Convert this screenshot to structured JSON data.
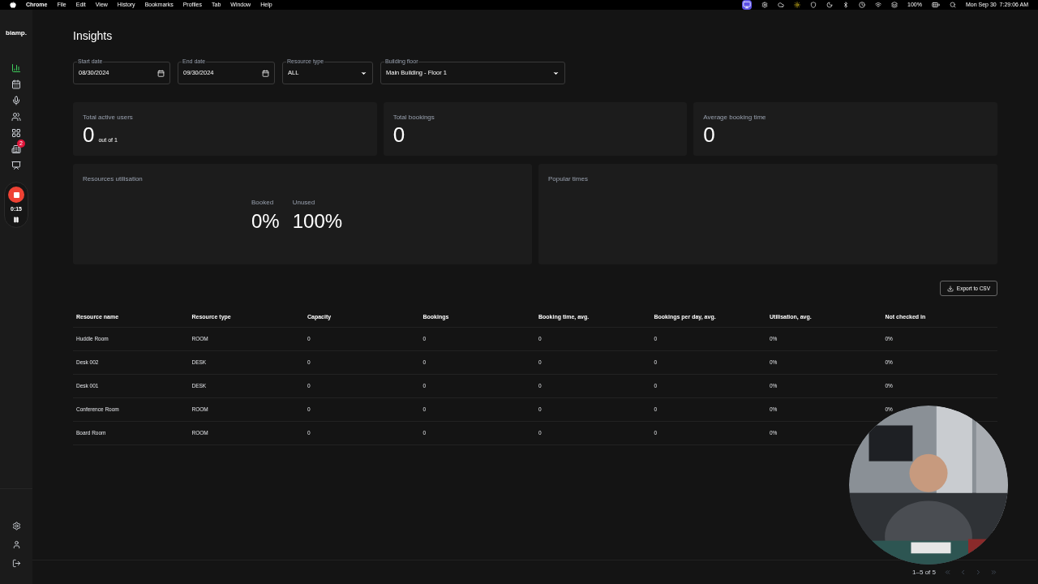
{
  "menu_bar": {
    "app": "Chrome",
    "menus": [
      "File",
      "Edit",
      "View",
      "History",
      "Bookmarks",
      "Profiles",
      "Tab",
      "Window",
      "Help"
    ],
    "battery": "100%",
    "clock": "Mon Sep 30  7:29:06 AM"
  },
  "sidebar": {
    "logo": "biamp.",
    "items": [
      {
        "kind": "chart",
        "selected": true
      },
      {
        "kind": "calendar",
        "selected": false
      },
      {
        "kind": "mic",
        "selected": false
      },
      {
        "kind": "people",
        "selected": false
      },
      {
        "kind": "grid",
        "selected": false
      },
      {
        "kind": "building",
        "selected": false,
        "badge": "2"
      },
      {
        "kind": "desk",
        "selected": false
      }
    ],
    "recorder": {
      "time": "0:15"
    },
    "bottom_items": [
      {
        "kind": "settings"
      },
      {
        "kind": "user"
      },
      {
        "kind": "logout"
      }
    ]
  },
  "page": {
    "title": "Insights"
  },
  "filters": [
    {
      "kind": "date",
      "label": "Start date",
      "value": "08/30/2024"
    },
    {
      "kind": "date",
      "label": "End date",
      "value": "09/30/2024"
    },
    {
      "kind": "select",
      "label": "Resource type",
      "value": "ALL"
    },
    {
      "kind": "select",
      "label": "Building floor",
      "value": "Main Building - Floor 1"
    }
  ],
  "stats": [
    {
      "label": "Total active users",
      "value": "0",
      "suffix": "out of 1"
    },
    {
      "label": "Total bookings",
      "value": "0"
    },
    {
      "label": "Average booking time",
      "value": "0"
    }
  ],
  "utilisation": {
    "title": "Resources utilisation",
    "figures": [
      {
        "label": "Booked",
        "value": "0%"
      },
      {
        "label": "Unused",
        "value": "100%"
      }
    ]
  },
  "popular_times": {
    "title": "Popular times"
  },
  "export_button": "Export to CSV",
  "table": {
    "columns": [
      "Resource name",
      "Resource type",
      "Capacity",
      "Bookings",
      "Booking time, avg.",
      "Bookings per day, avg.",
      "Utilisation, avg.",
      "Not checked in"
    ],
    "rows": [
      [
        "Huddle Room",
        "ROOM",
        "0",
        "0",
        "0",
        "0",
        "0%",
        "0%"
      ],
      [
        "Desk 002",
        "DESK",
        "0",
        "0",
        "0",
        "0",
        "0%",
        "0%"
      ],
      [
        "Desk 001",
        "DESK",
        "0",
        "0",
        "0",
        "0",
        "0%",
        "0%"
      ],
      [
        "Conference Room",
        "ROOM",
        "0",
        "0",
        "0",
        "0",
        "0%",
        "0%"
      ],
      [
        "Board Room",
        "ROOM",
        "0",
        "0",
        "0",
        "0",
        "0%"
      ]
    ]
  },
  "pagination": {
    "range": "1–5 of 5",
    "buttons": [
      {
        "kind": "first",
        "disabled": true
      },
      {
        "kind": "prev",
        "disabled": true
      },
      {
        "kind": "next",
        "disabled": true
      },
      {
        "kind": "last",
        "disabled": true
      }
    ]
  }
}
